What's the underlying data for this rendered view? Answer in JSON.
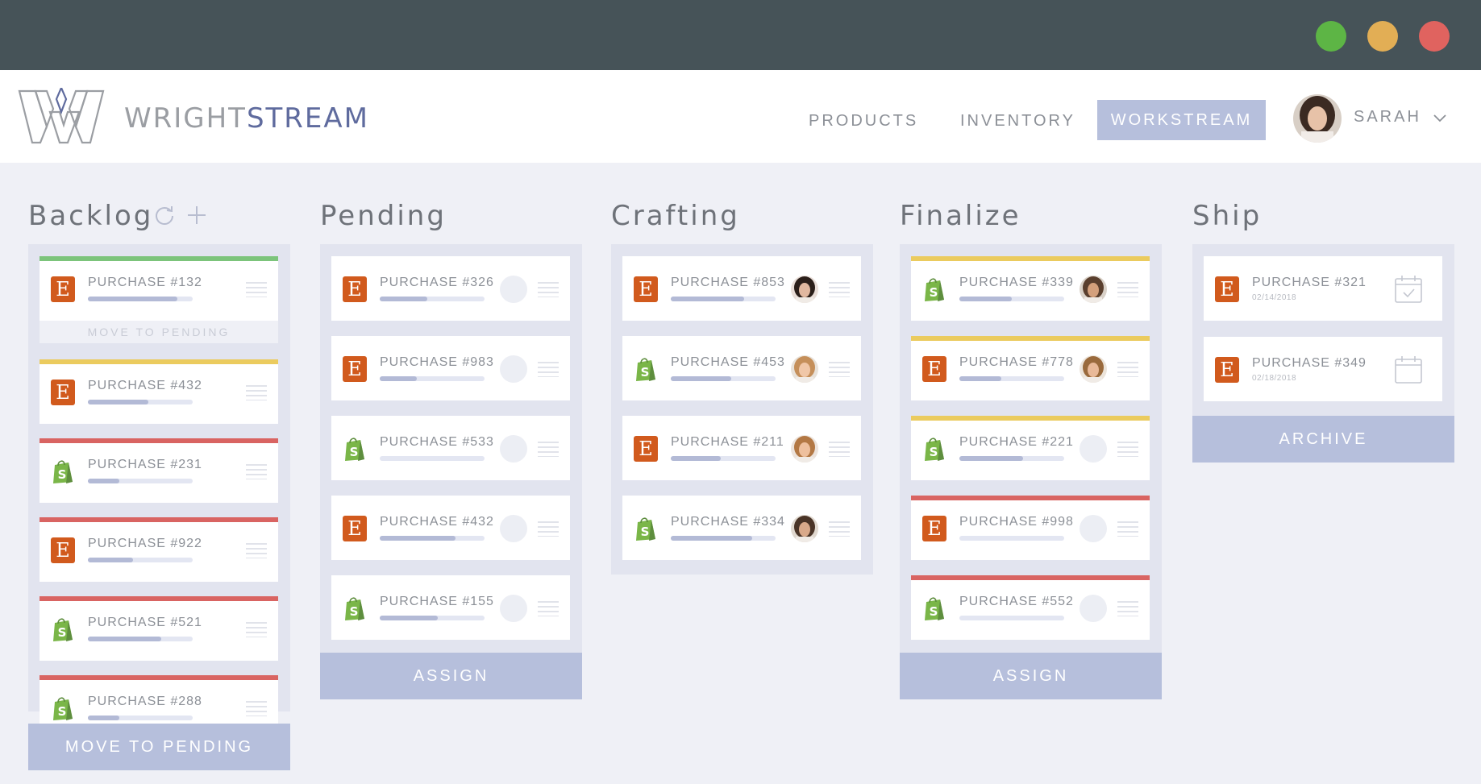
{
  "window": {
    "controls": {
      "green": "#5db545",
      "yellow": "#e2ae55",
      "red": "#e0635f"
    }
  },
  "brand": {
    "part1": "WRIGHT",
    "part2": "STREAM",
    "logo_icon": "wrightstream-logo"
  },
  "nav": {
    "items": [
      {
        "label": "PRODUCTS",
        "active": false
      },
      {
        "label": "INVENTORY",
        "active": false
      },
      {
        "label": "WORKSTREAM",
        "active": true
      }
    ],
    "user": {
      "name": "SARAH",
      "avatar_icon": "user-avatar",
      "menu_icon": "chevron-down-icon"
    }
  },
  "colors": {
    "green": "#7cc47b",
    "yellow": "#ebcb5e",
    "red": "#d96462",
    "accent": "#b6bfdc",
    "etsy": "#d15a1d",
    "shopify": "#7ab648"
  },
  "columns": [
    {
      "title": "Backlog",
      "tools": {
        "refresh_icon": "refresh-icon",
        "add_icon": "plus-icon"
      },
      "action": "MOVE TO PENDING",
      "cards": [
        {
          "label": "PURCHASE #132",
          "shop": "etsy",
          "flag": "green",
          "progress": 0.85,
          "sub_action": "MOVE TO PENDING"
        },
        {
          "label": "PURCHASE #432",
          "shop": "etsy",
          "flag": "yellow",
          "progress": 0.58
        },
        {
          "label": "PURCHASE #231",
          "shop": "shopify",
          "flag": "red",
          "progress": 0.3
        },
        {
          "label": "PURCHASE #922",
          "shop": "etsy",
          "flag": "red",
          "progress": 0.43
        },
        {
          "label": "PURCHASE #521",
          "shop": "shopify",
          "flag": "red",
          "progress": 0.7
        },
        {
          "label": "PURCHASE #288",
          "shop": "shopify",
          "flag": "red",
          "progress": 0.3
        }
      ]
    },
    {
      "title": "Pending",
      "action": "ASSIGN",
      "cards": [
        {
          "label": "PURCHASE #326",
          "shop": "etsy",
          "progress": 0.45,
          "assignee": "none"
        },
        {
          "label": "PURCHASE #983",
          "shop": "etsy",
          "progress": 0.35,
          "assignee": "none"
        },
        {
          "label": "PURCHASE #533",
          "shop": "shopify",
          "progress": 0.0,
          "assignee": "none"
        },
        {
          "label": "PURCHASE #432",
          "shop": "etsy",
          "progress": 0.72,
          "assignee": "none"
        },
        {
          "label": "PURCHASE #155",
          "shop": "shopify",
          "progress": 0.55,
          "assignee": "none"
        }
      ]
    },
    {
      "title": "Crafting",
      "cards": [
        {
          "label": "PURCHASE #853",
          "shop": "etsy",
          "progress": 0.7,
          "assignee": "avatar-a"
        },
        {
          "label": "PURCHASE #453",
          "shop": "shopify",
          "progress": 0.58,
          "assignee": "avatar-b"
        },
        {
          "label": "PURCHASE #211",
          "shop": "etsy",
          "progress": 0.48,
          "assignee": "avatar-c"
        },
        {
          "label": "PURCHASE #334",
          "shop": "shopify",
          "progress": 0.78,
          "assignee": "avatar-d"
        }
      ]
    },
    {
      "title": "Finalize",
      "action": "ASSIGN",
      "cards": [
        {
          "label": "PURCHASE #339",
          "shop": "shopify",
          "flag": "yellow",
          "progress": 0.5,
          "assignee": "avatar-e"
        },
        {
          "label": "PURCHASE #778",
          "shop": "etsy",
          "flag": "yellow",
          "progress": 0.4,
          "assignee": "avatar-f"
        },
        {
          "label": "PURCHASE #221",
          "shop": "shopify",
          "flag": "yellow",
          "progress": 0.61,
          "assignee": "none"
        },
        {
          "label": "PURCHASE #998",
          "shop": "etsy",
          "flag": "red",
          "progress": 0.0,
          "assignee": "none"
        },
        {
          "label": "PURCHASE #552",
          "shop": "shopify",
          "flag": "red",
          "progress": 0.0,
          "assignee": "none"
        }
      ]
    },
    {
      "title": "Ship",
      "action": "ARCHIVE",
      "cards": [
        {
          "label": "PURCHASE #321",
          "shop": "etsy",
          "date": "02/14/2018",
          "calendar": "calendar-check-icon"
        },
        {
          "label": "PURCHASE #349",
          "shop": "etsy",
          "date": "02/18/2018",
          "calendar": "calendar-icon"
        }
      ]
    }
  ]
}
